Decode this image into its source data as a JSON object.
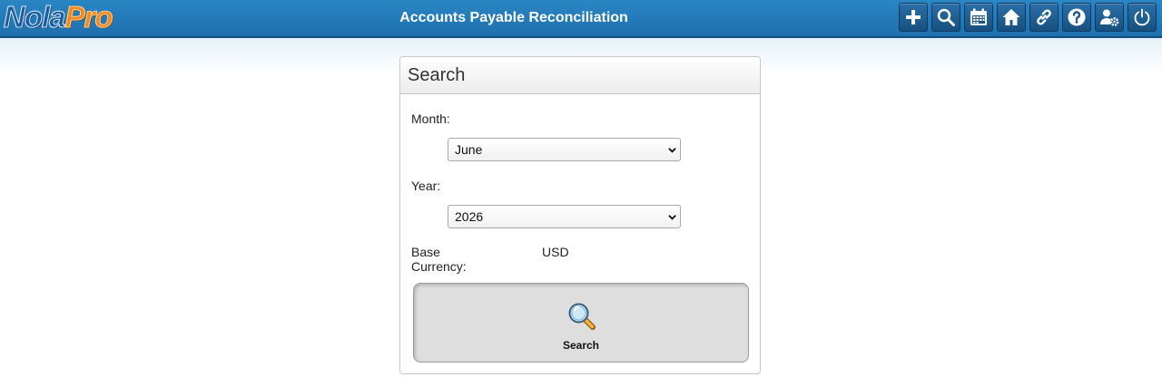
{
  "app": {
    "logo_part1": "Nola",
    "logo_part2": "Pro",
    "page_title": "Accounts Payable Reconciliation"
  },
  "toolbar": {
    "buttons": [
      {
        "name": "add",
        "icon": "plus-icon"
      },
      {
        "name": "search",
        "icon": "search-icon"
      },
      {
        "name": "calendar",
        "icon": "calendar-icon"
      },
      {
        "name": "home",
        "icon": "home-icon"
      },
      {
        "name": "links",
        "icon": "link-icon"
      },
      {
        "name": "help",
        "icon": "help-icon"
      },
      {
        "name": "user-settings",
        "icon": "user-gear-icon"
      },
      {
        "name": "logout",
        "icon": "power-icon"
      }
    ]
  },
  "search_panel": {
    "title": "Search",
    "month_label": "Month:",
    "month_value": "June",
    "year_label": "Year:",
    "year_value": "2026",
    "currency_label_line1": "Base",
    "currency_label_line2": "Currency:",
    "currency_value": "USD",
    "search_button_label": "Search"
  },
  "colors": {
    "header_blue": "#1e6fad",
    "toolbar_button": "#17507f",
    "logo_blue": "#1b5ea3",
    "logo_orange": "#f08a24",
    "search_button_bg": "#dedede"
  }
}
